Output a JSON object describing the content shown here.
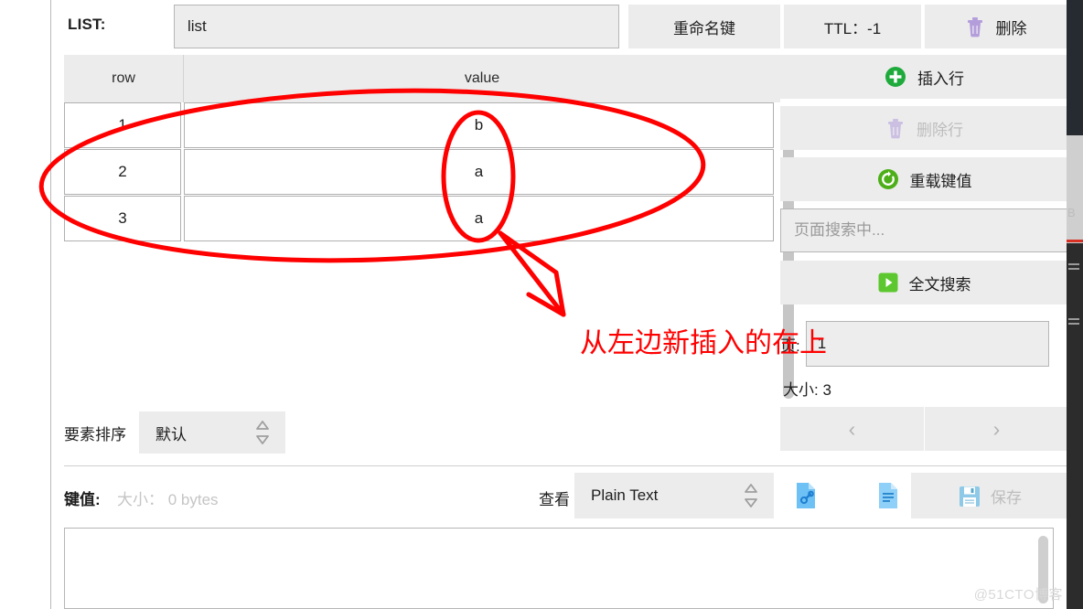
{
  "keybar": {
    "type_label": "LIST:",
    "key_name": "list",
    "rename_label": "重命名键",
    "ttl_label": "TTL：-1",
    "delete_label": "删除",
    "delete_icon": "trash-icon"
  },
  "table": {
    "columns": [
      "row",
      "value"
    ],
    "rows": [
      {
        "row": "1",
        "value": "b"
      },
      {
        "row": "2",
        "value": "a"
      },
      {
        "row": "3",
        "value": "a"
      }
    ]
  },
  "side": {
    "insert_row_label": "插入行",
    "insert_row_icon": "plus-circle-icon",
    "delete_row_label": "删除行",
    "delete_row_icon": "trash-icon",
    "delete_row_disabled": true,
    "reload_label": "重载键值",
    "reload_icon": "reload-icon",
    "search_placeholder": "页面搜索中...",
    "search_value": "",
    "fulltext_label": "全文搜索",
    "fulltext_icon": "play-icon",
    "page_label": "页:",
    "page_value": "1",
    "size_label": "大小: 3",
    "prev_label": "‹",
    "next_label": "›"
  },
  "sort": {
    "label": "要素排序",
    "value": "默认",
    "stepper_icon": "stepper-updown-icon"
  },
  "value_bar": {
    "label": "键值:",
    "size_text": "大小： 0 bytes",
    "view_label": "查看",
    "view_value": "Plain Text",
    "link_icon": "document-link-icon",
    "doc_icon": "document-text-icon",
    "save_label": "保存",
    "save_icon": "floppy-save-icon",
    "save_disabled": true
  },
  "editor": {
    "content": ""
  },
  "annotations": {
    "note_text": "从左边新插入的在上",
    "note_color": "#ff0000",
    "ellipse_outer": "red-ellipse-rows",
    "ellipse_inner": "red-ellipse-values",
    "arrow": "red-arrow"
  },
  "watermark": {
    "text": "@51CTO博客"
  },
  "colors": {
    "panel_bg": "#ffffff",
    "button_bg": "#ececec",
    "input_bg": "#ededed",
    "border": "#b6b6b6",
    "annotation_red": "#ff0000",
    "accent_green": "#3cb521",
    "accent_purple": "#b39ddb",
    "accent_blue": "#5eaff0"
  }
}
